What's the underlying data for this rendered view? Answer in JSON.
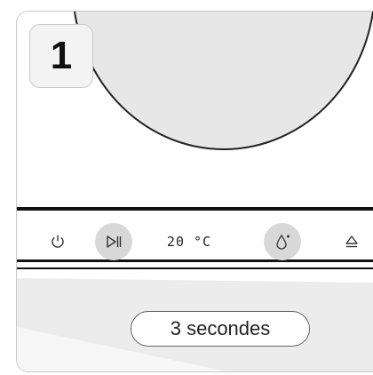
{
  "step": {
    "number": "1"
  },
  "panel": {
    "temperature": "20 °C",
    "controls": [
      {
        "icon": "power-icon",
        "highlighted": false
      },
      {
        "icon": "play-pause-icon",
        "highlighted": true
      },
      {
        "icon": "temperature-display",
        "highlighted": false
      },
      {
        "icon": "water-drop-icon",
        "highlighted": true
      },
      {
        "icon": "eject-icon",
        "highlighted": false
      }
    ]
  },
  "caption": {
    "duration": "3 secondes"
  },
  "colors": {
    "highlight": "#d8d8d8",
    "lid": "#e7e7e7",
    "wedge": "#ececec",
    "line": "#111111"
  }
}
